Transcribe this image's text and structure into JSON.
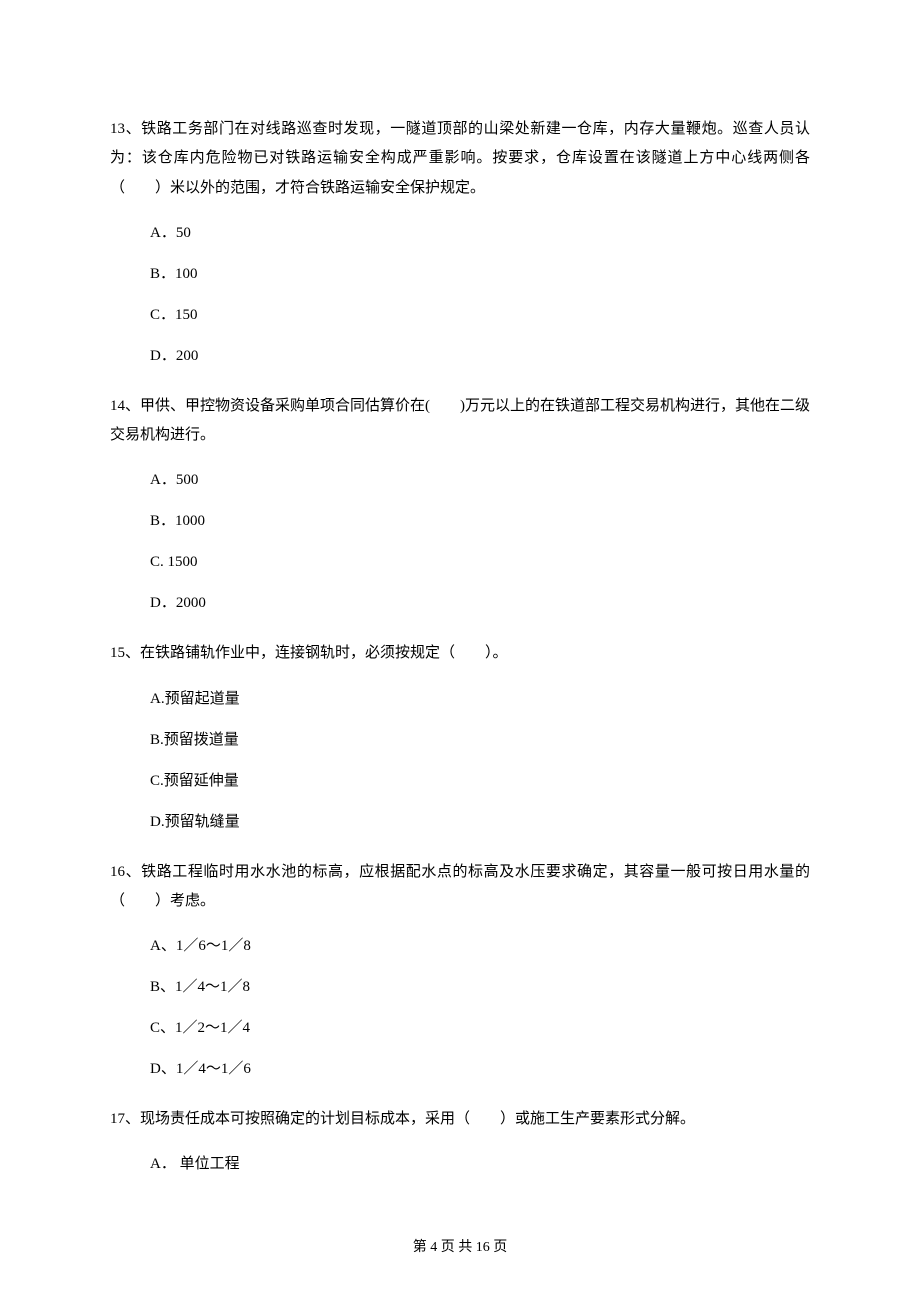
{
  "questions": [
    {
      "text": "13、铁路工务部门在对线路巡查时发现，一隧道顶部的山梁处新建一仓库，内存大量鞭炮。巡查人员认为：该仓库内危险物已对铁路运输安全构成严重影响。按要求，仓库设置在该隧道上方中心线两侧各（　　）米以外的范围，才符合铁路运输安全保护规定。",
      "options": [
        "A．50",
        "B．100",
        "C．150",
        "D．200"
      ]
    },
    {
      "text": "14、甲供、甲控物资设备采购单项合同估算价在(　　)万元以上的在铁道部工程交易机构进行，其他在二级交易机构进行。",
      "options": [
        "A．500",
        "B．1000",
        "C. 1500",
        "D．2000"
      ]
    },
    {
      "text": "15、在铁路铺轨作业中，连接钢轨时，必须按规定（　　）。",
      "options": [
        "A.预留起道量",
        "B.预留拨道量",
        "C.预留延伸量",
        "D.预留轨缝量"
      ]
    },
    {
      "text": "16、铁路工程临时用水水池的标高，应根据配水点的标高及水压要求确定，其容量一般可按日用水量的（　　）考虑。",
      "options": [
        "A、1／6～1／8",
        "B、1／4～1／8",
        "C、1／2～1／4",
        "D、1／4～1／6"
      ]
    },
    {
      "text": "17、现场责任成本可按照确定的计划目标成本，采用（　　）或施工生产要素形式分解。",
      "options": [
        "A． 单位工程"
      ]
    }
  ],
  "footer": "第 4 页 共 16 页"
}
